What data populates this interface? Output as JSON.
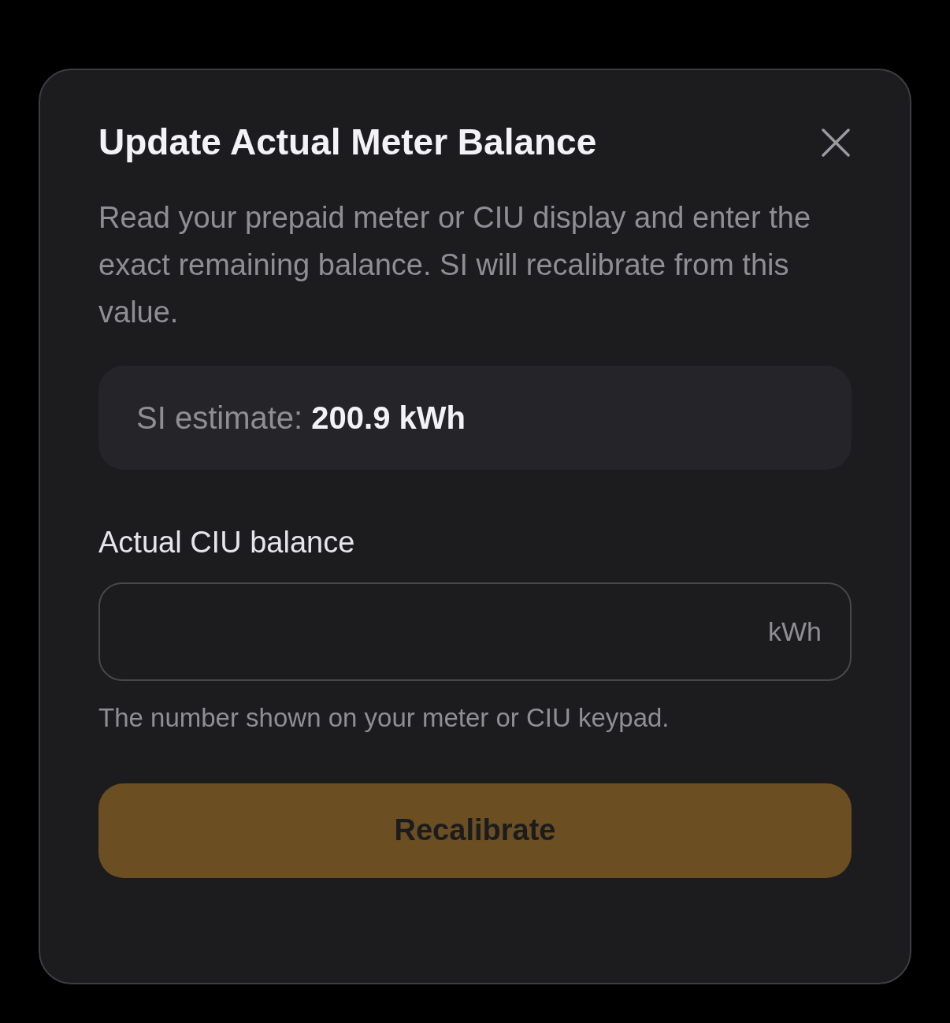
{
  "dialog": {
    "title": "Update Actual Meter Balance",
    "description": "Read your prepaid meter or CIU display and enter the exact remaining balance. SI will recalibrate from this value.",
    "estimate": "SI estimate: **200.9 kWh**",
    "field": {
      "label": "Actual CIU balance",
      "unit": "kWh",
      "hint": "The number shown on your meter or CIU keypad."
    },
    "button": {
      "label": "Recalibrate",
      "disabled": true
    }
  }
}
